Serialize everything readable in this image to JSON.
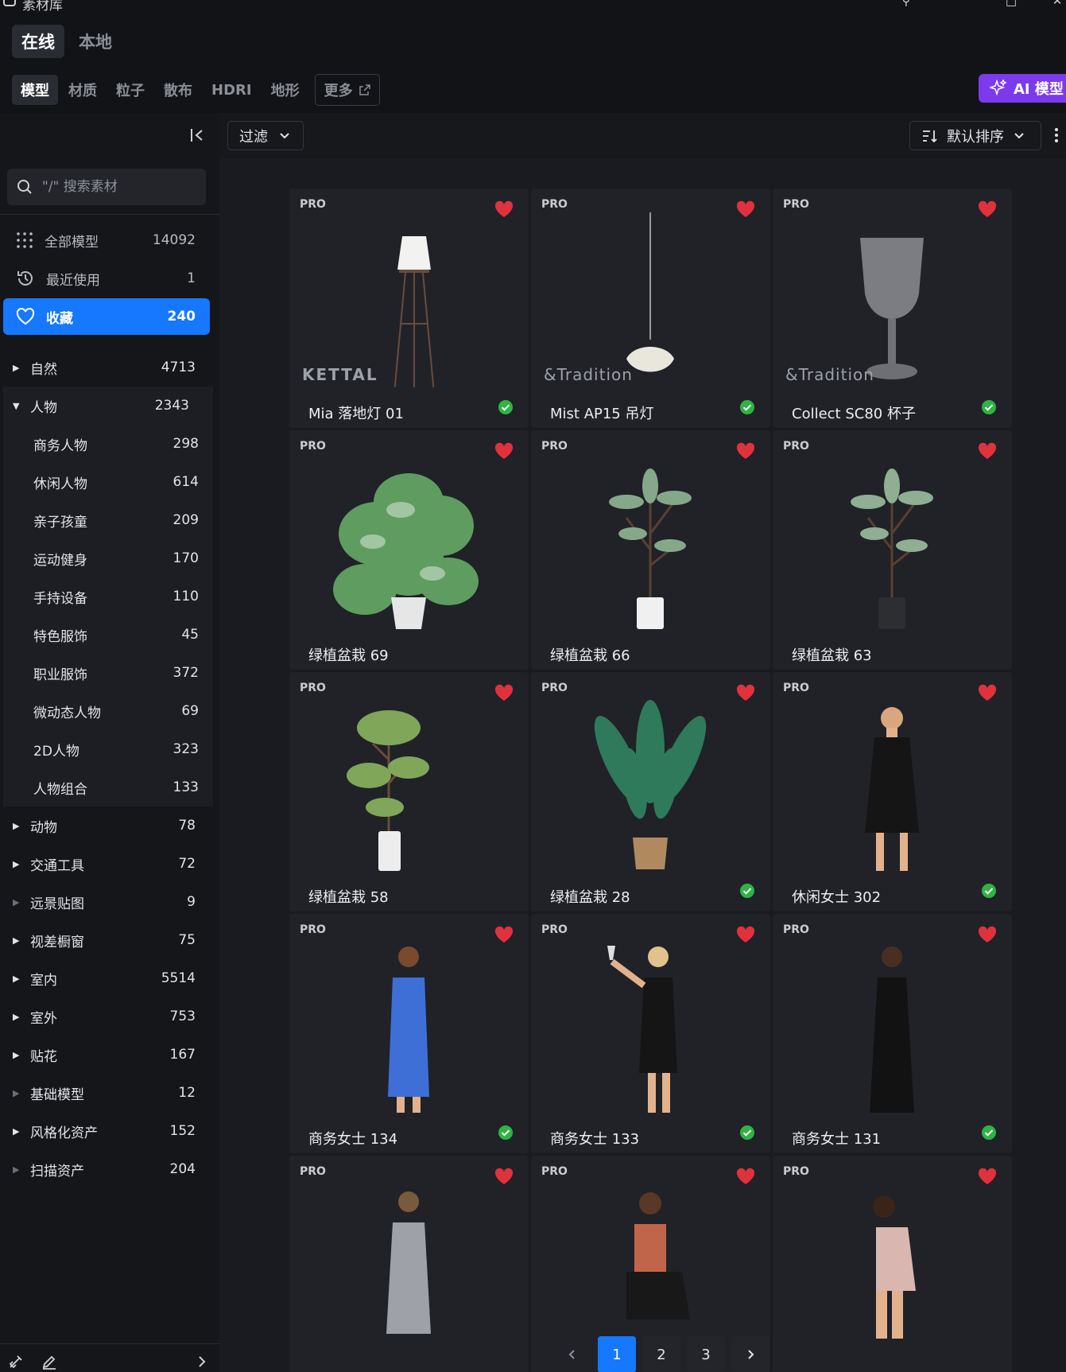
{
  "window": {
    "title": "素材库"
  },
  "top_tabs": [
    {
      "label": "在线",
      "active": true
    },
    {
      "label": "本地",
      "active": false
    }
  ],
  "category_tabs": [
    {
      "label": "模型",
      "active": true
    },
    {
      "label": "材质"
    },
    {
      "label": "粒子"
    },
    {
      "label": "散布"
    },
    {
      "label": "HDRI"
    },
    {
      "label": "地形"
    }
  ],
  "more_tab": {
    "label": "更多"
  },
  "ai_button": {
    "label": "AI 模型"
  },
  "search": {
    "placeholder": "\"/\" 搜索素材"
  },
  "quick_items": [
    {
      "label": "全部模型",
      "count": "14092",
      "icon": "grid-icon"
    },
    {
      "label": "最近使用",
      "count": "1",
      "icon": "history-icon"
    },
    {
      "label": "收藏",
      "count": "240",
      "icon": "heart-icon",
      "active": true
    }
  ],
  "tree": {
    "before": [
      {
        "label": "自然",
        "count": "4713"
      }
    ],
    "expanded": {
      "label": "人物",
      "count": "2343"
    },
    "children": [
      {
        "label": "商务人物",
        "count": "298"
      },
      {
        "label": "休闲人物",
        "count": "614"
      },
      {
        "label": "亲子孩童",
        "count": "209"
      },
      {
        "label": "运动健身",
        "count": "170"
      },
      {
        "label": "手持设备",
        "count": "110"
      },
      {
        "label": "特色服饰",
        "count": "45"
      },
      {
        "label": "职业服饰",
        "count": "372"
      },
      {
        "label": "微动态人物",
        "count": "69"
      },
      {
        "label": "2D人物",
        "count": "323"
      },
      {
        "label": "人物组合",
        "count": "133"
      }
    ],
    "after": [
      {
        "label": "动物",
        "count": "78",
        "dim": false
      },
      {
        "label": "交通工具",
        "count": "72",
        "dim": false
      },
      {
        "label": "远景贴图",
        "count": "9",
        "dim": true
      },
      {
        "label": "视差橱窗",
        "count": "75",
        "dim": false
      },
      {
        "label": "室内",
        "count": "5514",
        "dim": false
      },
      {
        "label": "室外",
        "count": "753",
        "dim": false
      },
      {
        "label": "贴花",
        "count": "167",
        "dim": false
      },
      {
        "label": "基础模型",
        "count": "12",
        "dim": true
      },
      {
        "label": "风格化资产",
        "count": "152",
        "dim": false
      },
      {
        "label": "扫描资产",
        "count": "204",
        "dim": true
      }
    ]
  },
  "toolbar": {
    "filter_label": "过滤",
    "sort_label": "默认排序"
  },
  "badge_text": "PRO",
  "cards": [
    {
      "name": "Mia 落地灯 01",
      "brand": "KETTAL",
      "thumb": "floor-lamp",
      "checked": true
    },
    {
      "name": "Mist AP15 吊灯",
      "brand": "&Tradition",
      "thumb": "pendant-lamp",
      "checked": true
    },
    {
      "name": "Collect SC80 杯子",
      "brand": "&Tradition",
      "thumb": "glass-cup",
      "checked": true
    },
    {
      "name": "绿植盆栽 69",
      "brand": "",
      "thumb": "monstera-plant",
      "checked": false
    },
    {
      "name": "绿植盆栽 66",
      "brand": "",
      "thumb": "plant-white-pot",
      "checked": false
    },
    {
      "name": "绿植盆栽 63",
      "brand": "",
      "thumb": "plant-black-pot",
      "checked": false
    },
    {
      "name": "绿植盆栽 58",
      "brand": "",
      "thumb": "tree-white-pot",
      "checked": false
    },
    {
      "name": "绿植盆栽 28",
      "brand": "",
      "thumb": "banana-plant",
      "checked": true
    },
    {
      "name": "休闲女士 302",
      "brand": "",
      "thumb": "woman-black-dress",
      "checked": true
    },
    {
      "name": "商务女士 134",
      "brand": "",
      "thumb": "woman-blue-dress",
      "checked": true
    },
    {
      "name": "商务女士 133",
      "brand": "",
      "thumb": "woman-with-glass",
      "checked": true
    },
    {
      "name": "商务女士 131",
      "brand": "",
      "thumb": "woman-long-dress",
      "checked": true
    },
    {
      "name": "",
      "brand": "",
      "thumb": "woman-grey-dress",
      "checked": false
    },
    {
      "name": "",
      "brand": "",
      "thumb": "woman-sitting",
      "checked": false
    },
    {
      "name": "",
      "brand": "",
      "thumb": "woman-crouching",
      "checked": false
    }
  ],
  "pagination": {
    "pages": [
      "1",
      "2",
      "3"
    ],
    "current": "1"
  },
  "colors": {
    "accent": "#1677ff",
    "ai": "#7c3aed",
    "fav": "#e0323c",
    "check": "#2fb344"
  }
}
